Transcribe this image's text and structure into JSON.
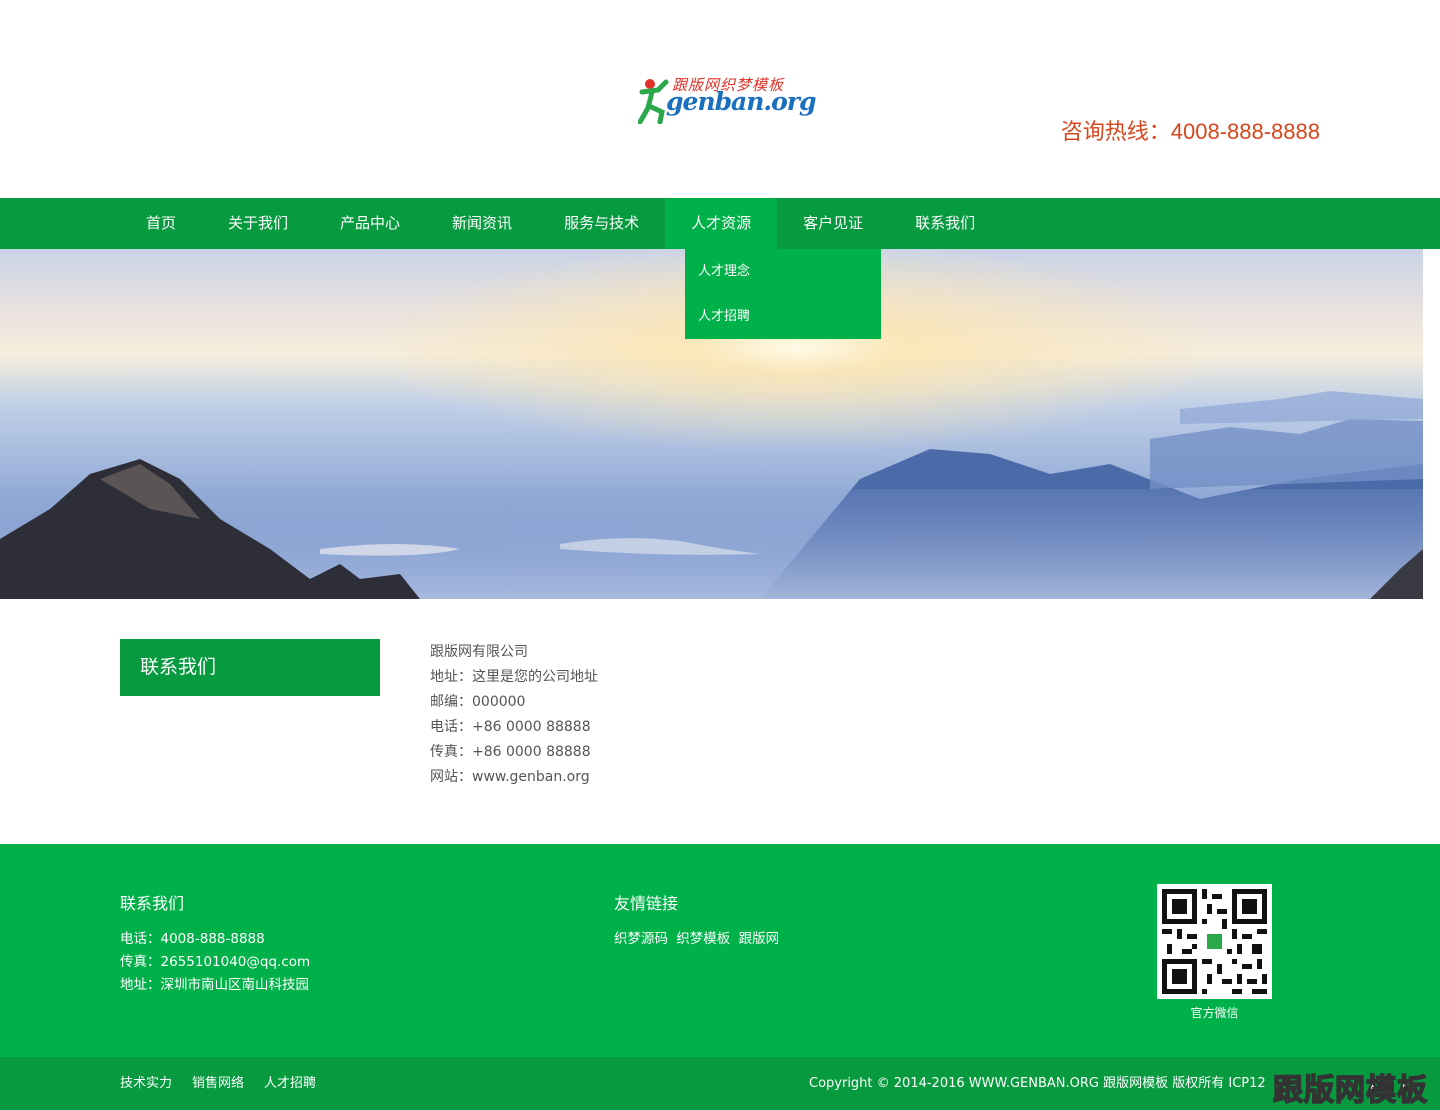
{
  "header": {
    "logo_top": "跟版网织梦模板",
    "logo_main": "genban.org",
    "hotline": "咨询热线：4008-888-8888"
  },
  "nav": {
    "items": [
      {
        "label": "首页"
      },
      {
        "label": "关于我们"
      },
      {
        "label": "产品中心"
      },
      {
        "label": "新闻资讯"
      },
      {
        "label": "服务与技术"
      },
      {
        "label": "人才资源"
      },
      {
        "label": "客户见证"
      },
      {
        "label": "联系我们"
      }
    ],
    "active_index": 5,
    "dropdown": [
      {
        "label": "人才理念"
      },
      {
        "label": "人才招聘"
      }
    ]
  },
  "content": {
    "side_title": "联系我们",
    "lines": [
      "跟版网有限公司",
      "地址：这里是您的公司地址",
      "邮编：000000",
      "电话：+86 0000 88888",
      "传真：+86 0000 88888",
      "网站：www.genban.org"
    ]
  },
  "footer": {
    "contact_title": "联系我们",
    "contact_lines": [
      "电话：4008-888-8888",
      "传真：2655101040@qq.com",
      "地址：深圳市南山区南山科技园"
    ],
    "links_title": "友情链接",
    "links": [
      "织梦源码",
      "织梦模板",
      "跟版网"
    ],
    "qr_caption": "官方微信"
  },
  "bottom": {
    "links": [
      "技术实力",
      "销售网络",
      "人才招聘"
    ],
    "copyright": "Copyright © 2014-2016 WWW.GENBAN.ORG 跟版网模板 版权所有    ICP12",
    "watermark": "跟版网模板"
  },
  "colors": {
    "nav_green": "#079a3f",
    "accent_green": "#00b14a",
    "hotline_red": "#d8461d"
  }
}
